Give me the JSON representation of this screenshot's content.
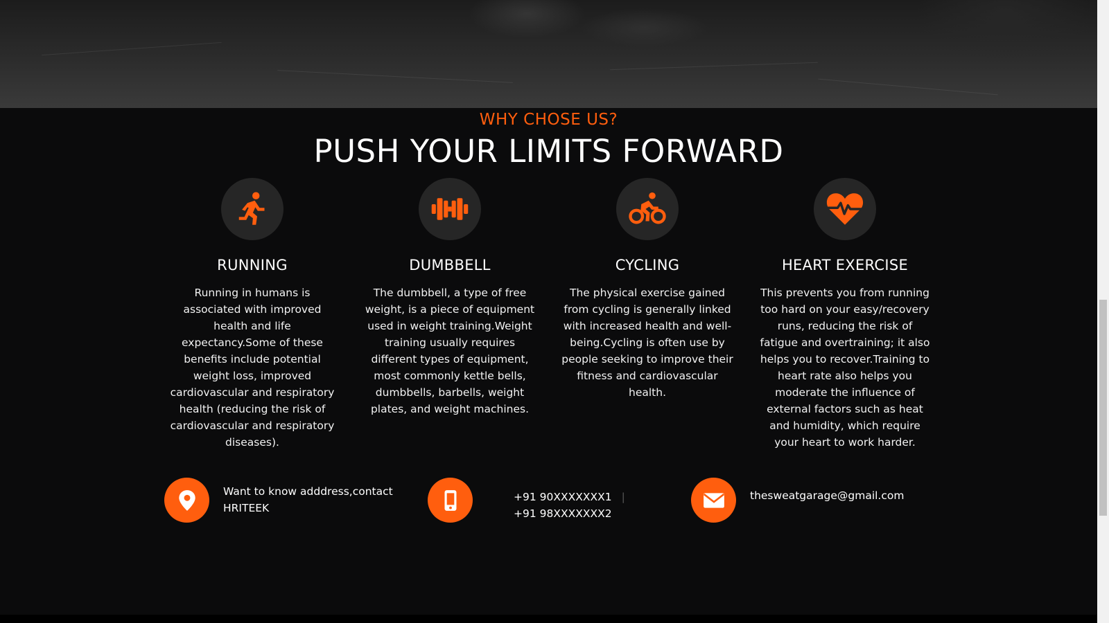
{
  "section": {
    "eyebrow": "WHY CHOSE US?",
    "headline": "PUSH YOUR LIMITS FORWARD"
  },
  "features": [
    {
      "icon": "running-icon",
      "title": "RUNNING",
      "description": "Running in humans is associated with improved health and life expectancy.Some of these benefits include potential weight loss, improved cardiovascular and respiratory health (reducing the risk of cardiovascular and respiratory diseases)."
    },
    {
      "icon": "dumbbell-icon",
      "title": "DUMBBELL",
      "description": "The dumbbell, a type of free weight, is a piece of equipment used in weight training.Weight training usually requires different types of equipment, most commonly kettle bells, dumbbells, barbells, weight plates, and weight machines."
    },
    {
      "icon": "cycling-icon",
      "title": "CYCLING",
      "description": "The physical exercise gained from cycling is generally linked with increased health and well-being.Cycling is often use by people seeking to improve their fitness and cardiovascular health."
    },
    {
      "icon": "heartbeat-icon",
      "title": "HEART EXERCISE",
      "description": "This prevents you from running too hard on your easy/recovery runs, reducing the risk of fatigue and overtraining; it also helps you to recover.Training to heart rate also helps you moderate the influence of external factors such as heat and humidity, which require your heart to work harder."
    }
  ],
  "contact": {
    "address": {
      "icon": "map-marker-icon",
      "line1": "Want to know adddress,contact",
      "line2": "HRITEEK"
    },
    "phone": {
      "icon": "mobile-phone-icon",
      "number1": "+91 90XXXXXXX1",
      "separator": "|",
      "number2": "+91 98XXXXXXX2"
    },
    "email": {
      "icon": "envelope-icon",
      "address": "thesweatgarage@gmail.com"
    }
  },
  "colors": {
    "accent": "#ff5e0e",
    "background": "#0b0b0c",
    "icon_circle": "#262626",
    "text": "#ffffff"
  }
}
